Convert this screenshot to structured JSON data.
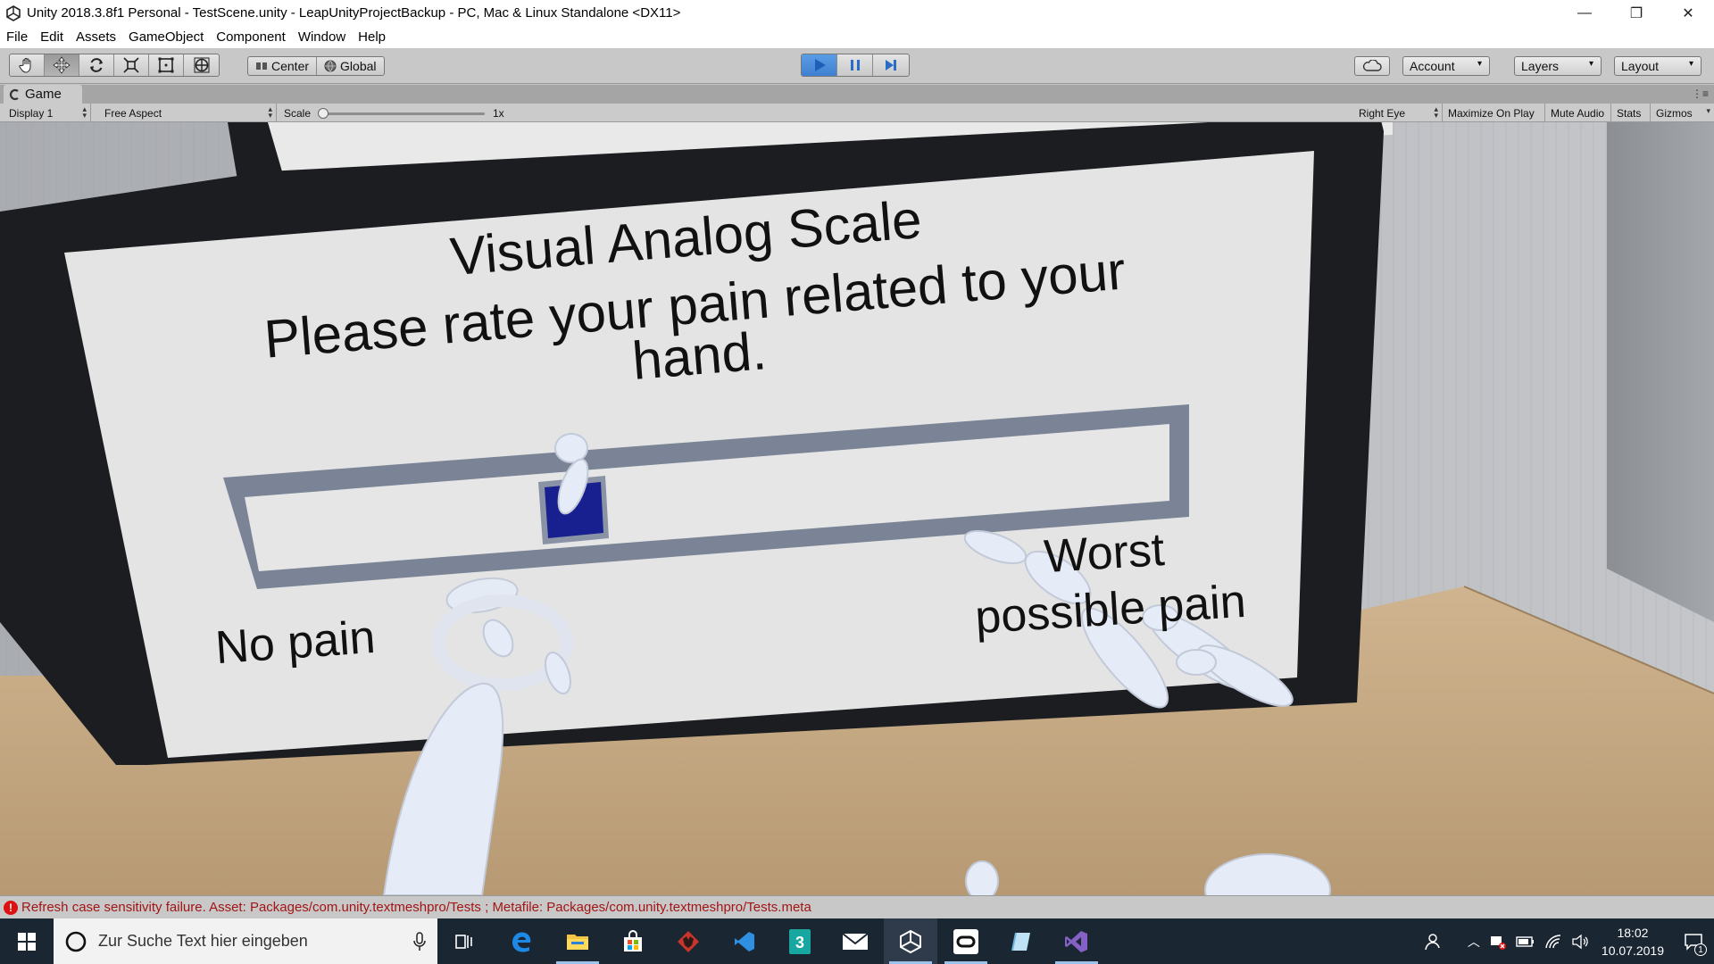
{
  "window": {
    "title": "Unity 2018.3.8f1 Personal - TestScene.unity - LeapUnityProjectBackup - PC, Mac & Linux Standalone <DX11>",
    "minimize_glyph": "—",
    "maximize_glyph": "❐",
    "close_glyph": "✕"
  },
  "menu": [
    "File",
    "Edit",
    "Assets",
    "GameObject",
    "Component",
    "Window",
    "Help"
  ],
  "toolbar": {
    "transform_tools": [
      "hand-icon",
      "move-icon",
      "rotate-icon",
      "scale-icon",
      "rect-icon",
      "transform-icon"
    ],
    "active_tool": "move-icon",
    "pivot_center": "Center",
    "pivot_global": "Global",
    "play_controls": [
      "play-icon",
      "pause-icon",
      "step-icon"
    ],
    "play_active": true,
    "account": "Account",
    "layers": "Layers",
    "layout": "Layout"
  },
  "game_tab": {
    "label": "Game",
    "display": "Display 1",
    "aspect": "Free Aspect",
    "scale_label": "Scale",
    "scale_value": "1x",
    "scale_fraction": 0.0,
    "eye": "Right Eye",
    "maximize_on_play": "Maximize On Play",
    "mute_audio": "Mute Audio",
    "stats": "Stats",
    "gizmos": "Gizmos"
  },
  "scene": {
    "title_line1": "Visual Analog Scale",
    "title_line2": "Please rate your pain related to your",
    "title_line3": "hand.",
    "left_label": "No pain",
    "right_label_line1": "Worst",
    "right_label_line2": "possible pain",
    "slider_value": 0.34,
    "colors": {
      "board_bg": "#e4e4e4",
      "board_frame": "#1c1d21",
      "slider_frame": "#7a8496",
      "handle": "#17208e",
      "hand": "#e6ecf7",
      "floor": "#c7ad88"
    }
  },
  "status": {
    "message": "Refresh case sensitivity failure. Asset: Packages/com.unity.textmeshpro/Tests ; Metafile: Packages/com.unity.textmeshpro/Tests.meta"
  },
  "taskbar": {
    "search_placeholder": "Zur Suche Text hier eingeben",
    "apps": [
      "task-view-icon",
      "edge-icon",
      "file-explorer-icon",
      "store-icon",
      "app-fox-icon",
      "visual-studio-code-icon",
      "app-3-icon",
      "mail-icon",
      "unity-icon",
      "oculus-icon",
      "notes-icon",
      "visual-studio-icon"
    ],
    "time": "18:02",
    "date": "10.07.2019",
    "notification_count": "1"
  }
}
